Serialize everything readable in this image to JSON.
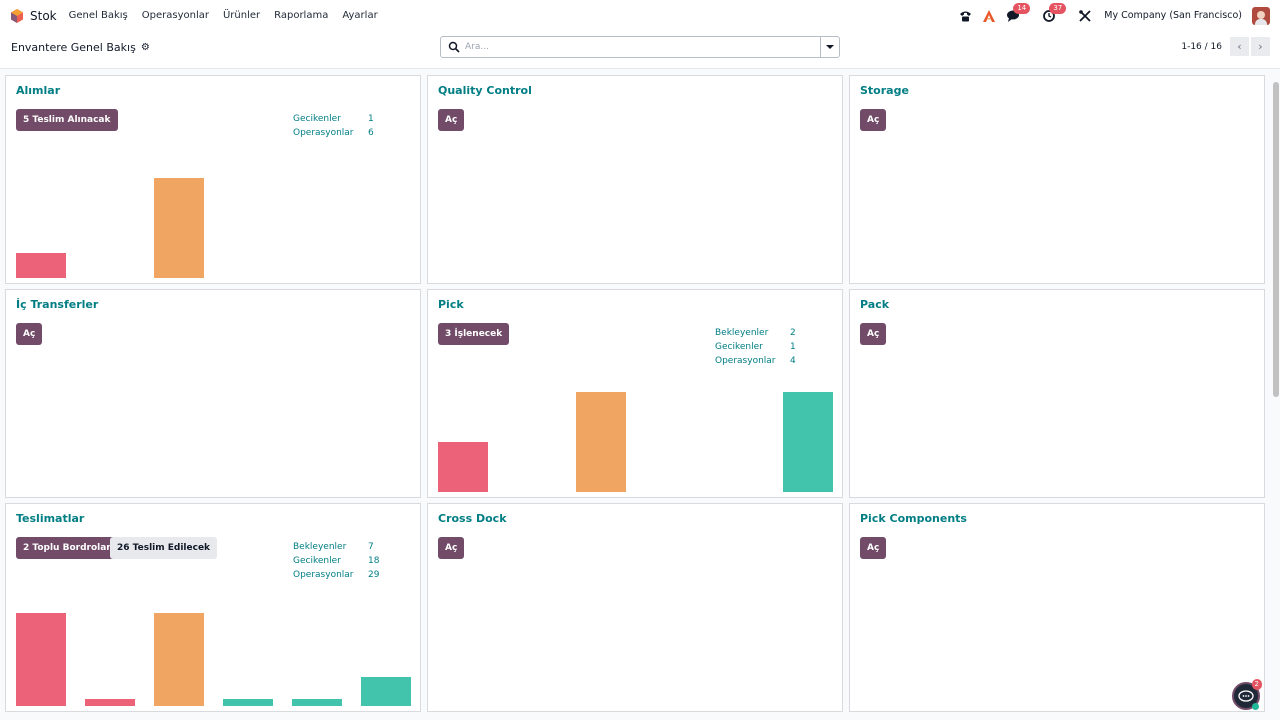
{
  "navbar": {
    "app_name": "Stok",
    "menu": [
      "Genel Bakış",
      "Operasyonlar",
      "Ürünler",
      "Raporlama",
      "Ayarlar"
    ],
    "badges": {
      "messages": "14",
      "activities": "37"
    },
    "company": "My Company (San Francisco)"
  },
  "control": {
    "breadcrumb": "Envantere Genel Bakış",
    "search_placeholder": "Ara...",
    "pager": "1-16 / 16"
  },
  "colors": {
    "late": "#ec6279",
    "today": "#f0a562",
    "future": "#41c4ab",
    "primary": "#714b67",
    "title": "#017e84"
  },
  "cards": [
    {
      "title": "Alımlar",
      "primary_button": "5 Teslim Alınacak",
      "stats": [
        {
          "label": "Gecikenler",
          "value": "1"
        },
        {
          "label": "Operasyonlar",
          "value": "6"
        }
      ],
      "bars": [
        {
          "value": 1,
          "color": "late"
        },
        {
          "value": 0
        },
        {
          "value": 4,
          "color": "today"
        },
        {
          "value": 0
        },
        {
          "value": 0
        },
        {
          "value": 0
        }
      ]
    },
    {
      "title": "Quality Control",
      "primary_button": "Aç"
    },
    {
      "title": "Storage",
      "primary_button": "Aç"
    },
    {
      "title": "İç Transferler",
      "primary_button": "Aç"
    },
    {
      "title": "Pick",
      "primary_button": "3 İşlenecek",
      "stats": [
        {
          "label": "Bekleyenler",
          "value": "2"
        },
        {
          "label": "Gecikenler",
          "value": "1"
        },
        {
          "label": "Operasyonlar",
          "value": "4"
        }
      ],
      "bars": [
        {
          "value": 1,
          "color": "late"
        },
        {
          "value": 0
        },
        {
          "value": 2,
          "color": "today"
        },
        {
          "value": 0
        },
        {
          "value": 0
        },
        {
          "value": 2,
          "color": "future"
        }
      ]
    },
    {
      "title": "Pack",
      "primary_button": "Aç"
    },
    {
      "title": "Teslimatlar",
      "primary_button": "2 Toplu Bordrolar",
      "secondary_button": "26 Teslim Edilecek",
      "stats": [
        {
          "label": "Bekleyenler",
          "value": "7"
        },
        {
          "label": "Gecikenler",
          "value": "18"
        },
        {
          "label": "Operasyonlar",
          "value": "29"
        }
      ],
      "bars": [
        {
          "value": 13,
          "color": "late"
        },
        {
          "value": 1,
          "color": "late"
        },
        {
          "value": 13,
          "color": "today"
        },
        {
          "value": 1,
          "color": "future"
        },
        {
          "value": 1,
          "color": "future"
        },
        {
          "value": 4,
          "color": "future"
        }
      ]
    },
    {
      "title": "Cross Dock",
      "primary_button": "Aç"
    },
    {
      "title": "Pick Components",
      "primary_button": "Aç"
    }
  ],
  "chat": {
    "badge": "2"
  }
}
